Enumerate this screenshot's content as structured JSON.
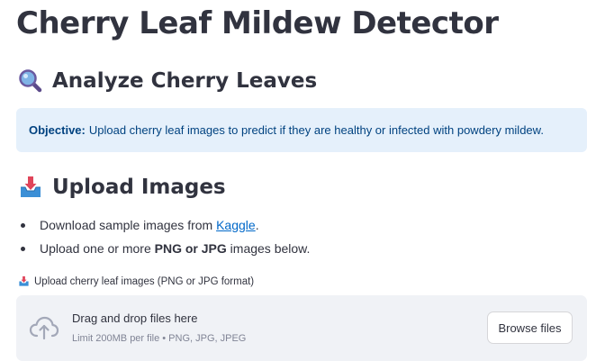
{
  "page_title": "Cherry Leaf Mildew Detector",
  "analyze_section": {
    "icon": "magnifying-glass-icon",
    "heading": "Analyze Cherry Leaves"
  },
  "info_box": {
    "label": "Objective:",
    "text": "Upload cherry leaf images to predict if they are healthy or infected with powdery mildew.",
    "background": "#e5f0fb",
    "text_color": "#004280"
  },
  "upload_section": {
    "icon": "inbox-tray-icon",
    "heading": "Upload Images",
    "bullets": [
      {
        "prefix": "Download sample images from ",
        "link": "Kaggle",
        "suffix": "."
      },
      {
        "prefix": "Upload one or more ",
        "bold": "PNG or JPG",
        "suffix": " images below."
      }
    ]
  },
  "file_uploader": {
    "label_icon": "inbox-tray-icon",
    "label": "Upload cherry leaf images (PNG or JPG format)",
    "dropzone_icon": "cloud-upload-icon",
    "dropzone_title": "Drag and drop files here",
    "dropzone_hint": "Limit 200MB per file • PNG, JPG, JPEG",
    "browse_button": "Browse files"
  },
  "colors": {
    "text": "#31333f",
    "link": "#0068c9",
    "dropzone_bg": "#f0f2f6",
    "muted": "#808495"
  }
}
